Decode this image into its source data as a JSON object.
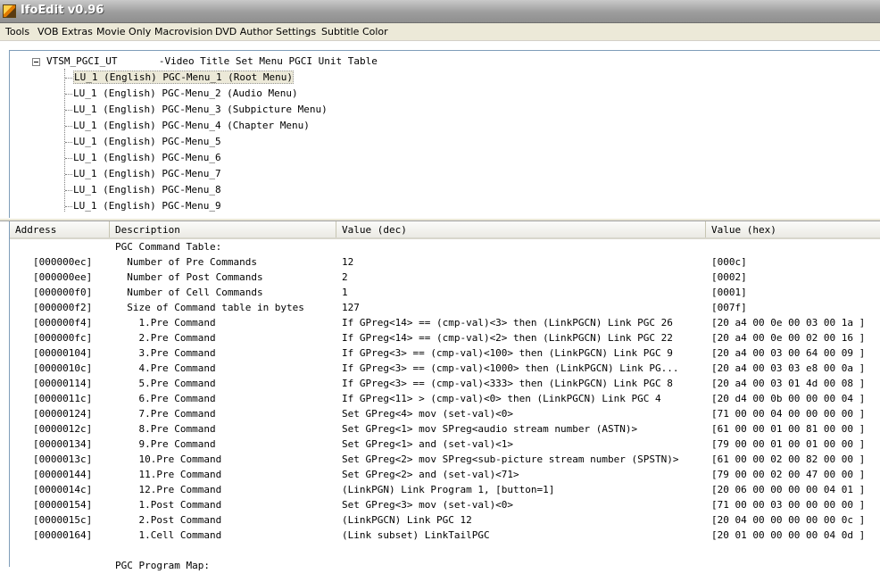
{
  "window": {
    "title": "IfoEdit v0.96"
  },
  "menu": [
    "Tools",
    "VOB Extras",
    "Movie Only",
    "Macrovision",
    "DVD Author",
    "Settings",
    "Subtitle Color"
  ],
  "tree": {
    "root": "VTSM_PGCI_UT       -Video Title Set Menu PGCI Unit Table",
    "items": [
      "LU_1 (English) PGC-Menu_1 (Root Menu)",
      "LU_1 (English) PGC-Menu_2 (Audio Menu)",
      "LU_1 (English) PGC-Menu_3 (Subpicture Menu)",
      "LU_1 (English) PGC-Menu_4 (Chapter Menu)",
      "LU_1 (English) PGC-Menu_5",
      "LU_1 (English) PGC-Menu_6",
      "LU_1 (English) PGC-Menu_7",
      "LU_1 (English) PGC-Menu_8",
      "LU_1 (English) PGC-Menu_9"
    ],
    "selected_index": 0
  },
  "list": {
    "columns": [
      "Address",
      "Description",
      "Value (dec)",
      "Value (hex)"
    ],
    "rows": [
      [
        "",
        "PGC Command Table:",
        "",
        ""
      ],
      [
        "[000000ec]",
        "  Number of Pre Commands",
        "12",
        "[000c]"
      ],
      [
        "[000000ee]",
        "  Number of Post Commands",
        "2",
        "[0002]"
      ],
      [
        "[000000f0]",
        "  Number of Cell Commands",
        "1",
        "[0001]"
      ],
      [
        "[000000f2]",
        "  Size of Command table in bytes",
        "127",
        "[007f]"
      ],
      [
        "[000000f4]",
        "    1.Pre Command",
        "If GPreg<14> == (cmp-val)<3> then (LinkPGCN) Link PGC 26",
        "[20 a4 00 0e 00 03 00 1a ]"
      ],
      [
        "[000000fc]",
        "    2.Pre Command",
        "If GPreg<14> == (cmp-val)<2> then (LinkPGCN) Link PGC 22",
        "[20 a4 00 0e 00 02 00 16 ]"
      ],
      [
        "[00000104]",
        "    3.Pre Command",
        "If GPreg<3> == (cmp-val)<100> then (LinkPGCN) Link PGC 9",
        "[20 a4 00 03 00 64 00 09 ]"
      ],
      [
        "[0000010c]",
        "    4.Pre Command",
        "If GPreg<3> == (cmp-val)<1000> then (LinkPGCN) Link PG...",
        "[20 a4 00 03 03 e8 00 0a ]"
      ],
      [
        "[00000114]",
        "    5.Pre Command",
        "If GPreg<3> == (cmp-val)<333> then (LinkPGCN) Link PGC 8",
        "[20 a4 00 03 01 4d 00 08 ]"
      ],
      [
        "[0000011c]",
        "    6.Pre Command",
        "If GPreg<11> > (cmp-val)<0> then (LinkPGCN) Link PGC 4",
        "[20 d4 00 0b 00 00 00 04 ]"
      ],
      [
        "[00000124]",
        "    7.Pre Command",
        "Set GPreg<4> mov (set-val)<0>",
        "[71 00 00 04 00 00 00 00 ]"
      ],
      [
        "[0000012c]",
        "    8.Pre Command",
        "Set GPreg<1> mov SPreg<audio stream number (ASTN)>",
        "[61 00 00 01 00 81 00 00 ]"
      ],
      [
        "[00000134]",
        "    9.Pre Command",
        "Set GPreg<1> and (set-val)<1>",
        "[79 00 00 01 00 01 00 00 ]"
      ],
      [
        "[0000013c]",
        "    10.Pre Command",
        "Set GPreg<2> mov SPreg<sub-picture stream number (SPSTN)>",
        "[61 00 00 02 00 82 00 00 ]"
      ],
      [
        "[00000144]",
        "    11.Pre Command",
        "Set GPreg<2> and (set-val)<71>",
        "[79 00 00 02 00 47 00 00 ]"
      ],
      [
        "[0000014c]",
        "    12.Pre Command",
        "(LinkPGN) Link Program 1, [button=1]",
        "[20 06 00 00 00 00 04 01 ]"
      ],
      [
        "[00000154]",
        "    1.Post Command",
        "Set GPreg<3> mov (set-val)<0>",
        "[71 00 00 03 00 00 00 00 ]"
      ],
      [
        "[0000015c]",
        "    2.Post Command",
        "(LinkPGCN) Link PGC 12",
        "[20 04 00 00 00 00 00 0c ]"
      ],
      [
        "[00000164]",
        "    1.Cell Command",
        "(Link subset) LinkTailPGC",
        "[20 01 00 00 00 00 04 0d ]"
      ],
      [
        "",
        "",
        "",
        ""
      ],
      [
        "",
        "PGC Program Map:",
        "",
        ""
      ]
    ]
  }
}
